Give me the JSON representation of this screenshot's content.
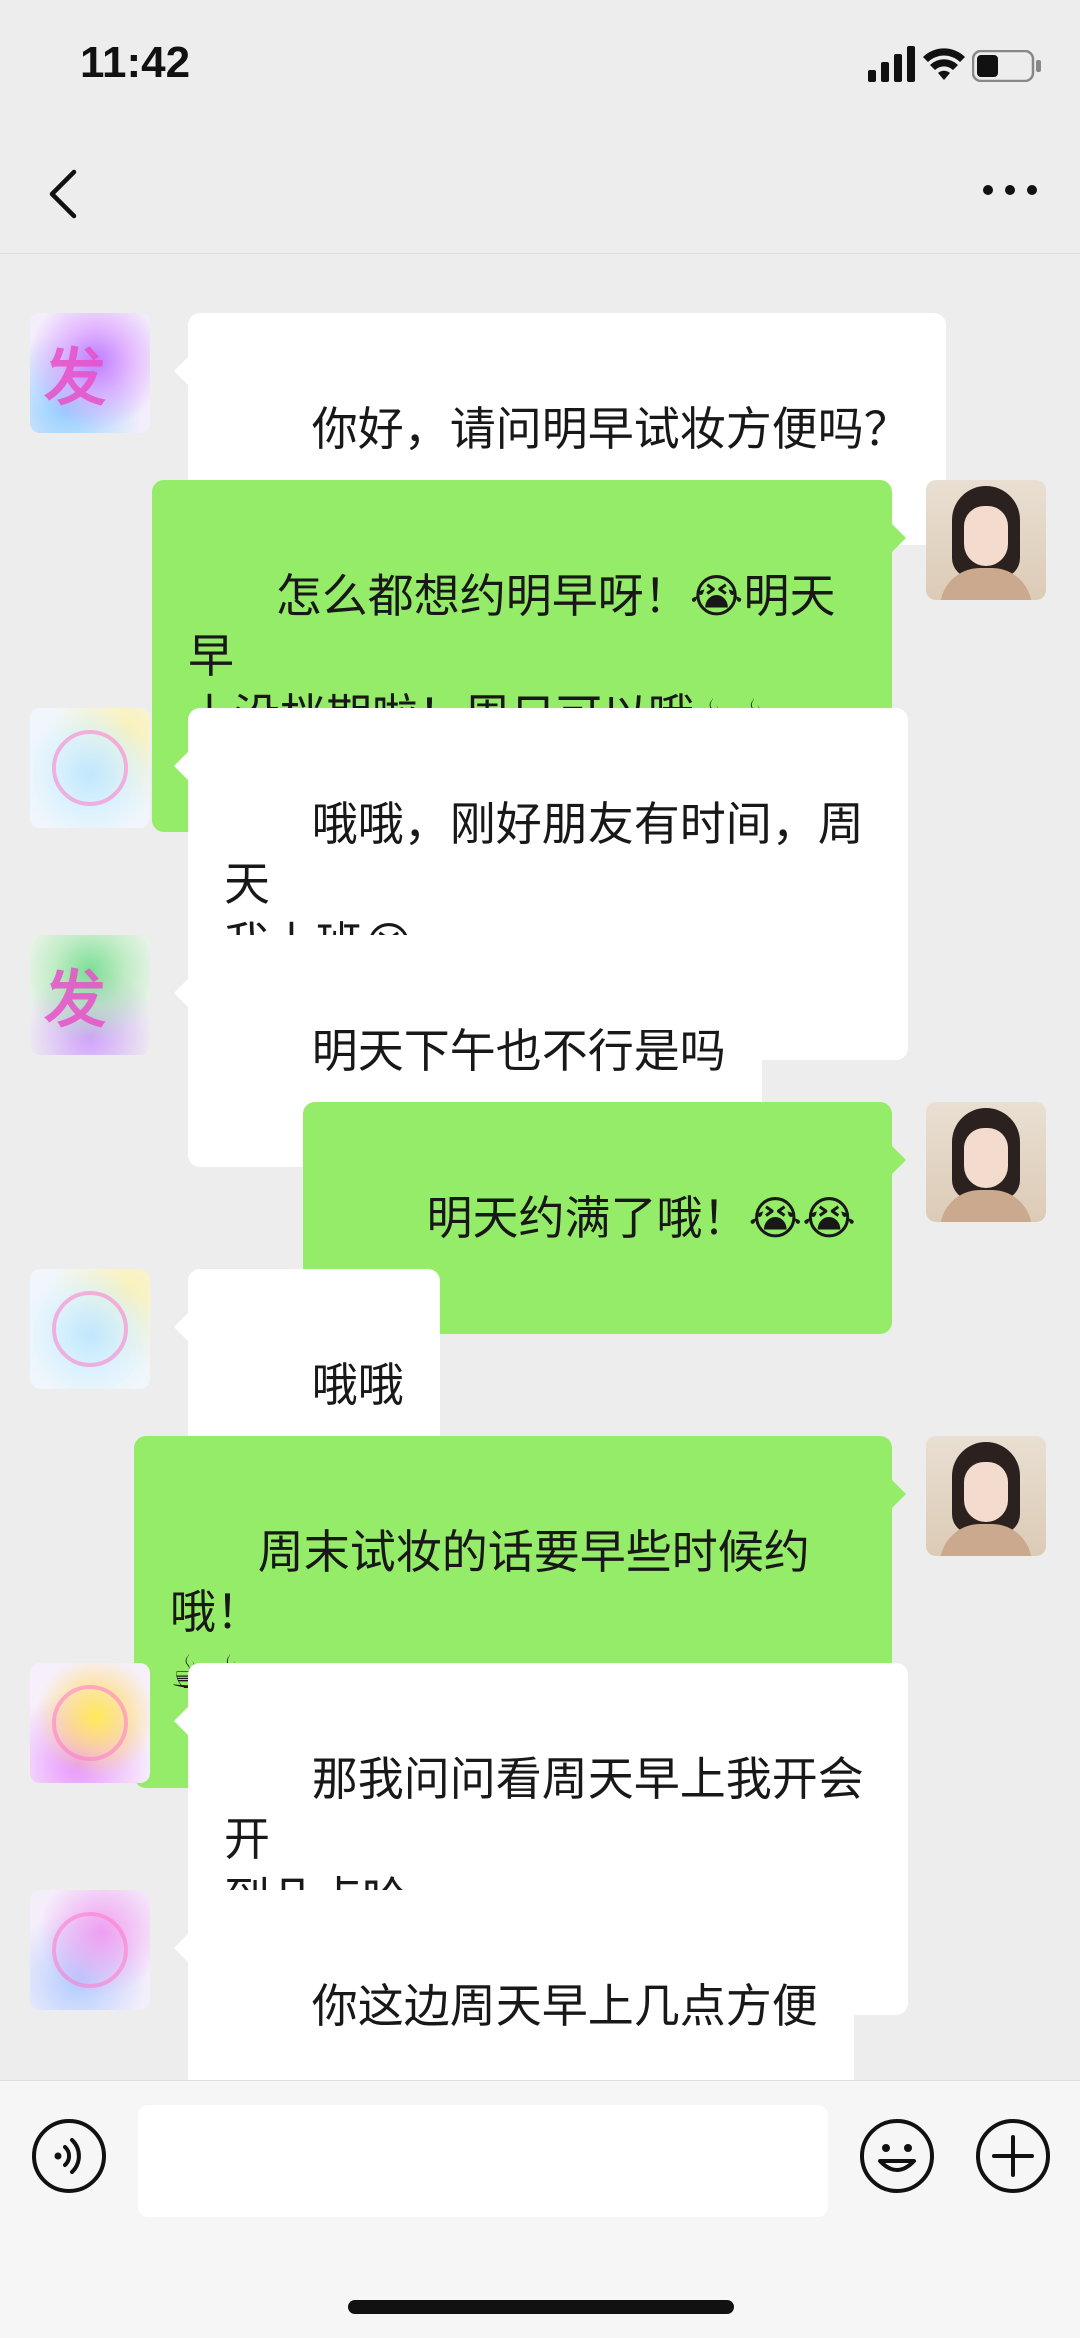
{
  "status_bar": {
    "time": "11:42",
    "battery_level": 0.4
  },
  "nav": {
    "title": "",
    "back_icon": "chevron-left-icon",
    "more_icon": "ellipsis-icon"
  },
  "messages": [
    {
      "direction": "in",
      "text": "你好，请问明早试妆方便吗？"
    },
    {
      "direction": "out",
      "text": "怎么都想约明早呀！😭明天早\n上没档期啦！周日可以哦☕☕"
    },
    {
      "direction": "in",
      "text": "哦哦，刚好朋友有时间，周天\n我上班😭"
    },
    {
      "direction": "in",
      "text": "明天下午也不行是吗"
    },
    {
      "direction": "out",
      "text": "明天约满了哦！😭😭"
    },
    {
      "direction": "in",
      "text": "哦哦"
    },
    {
      "direction": "out",
      "text": "周末试妆的话要早些时候约哦！\n☕☕"
    },
    {
      "direction": "in",
      "text": "那我问问看周天早上我开会开\n到几点哈"
    },
    {
      "direction": "in",
      "text": "你这边周天早上几点方便"
    }
  ],
  "avatars": {
    "incoming_badge_text": "发"
  },
  "input_bar": {
    "placeholder": "",
    "voice_icon": "voice-icon",
    "emoji_icon": "emoji-icon",
    "plus_icon": "plus-icon"
  }
}
